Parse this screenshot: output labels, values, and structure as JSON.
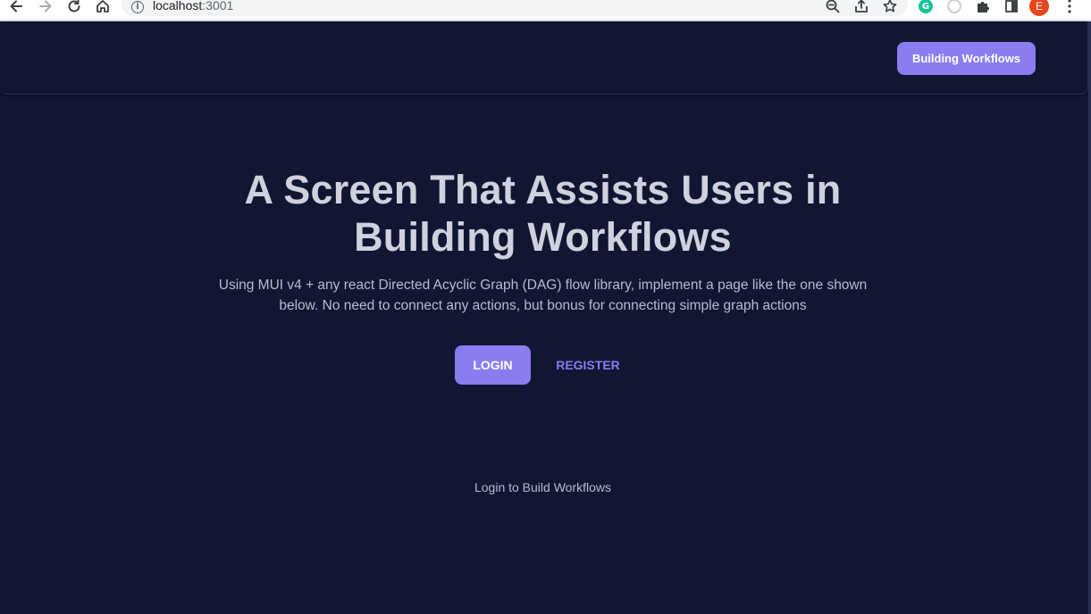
{
  "browser": {
    "url_host": "localhost",
    "url_port": ":3001",
    "profile_initial": "E",
    "grammarly_letter": "G",
    "icons": [
      "back-arrow-icon",
      "forward-arrow-icon",
      "reload-icon",
      "home-icon",
      "info-icon",
      "zoom-out-icon",
      "share-icon",
      "star-icon",
      "grammarly-icon",
      "extension-ring-icon",
      "puzzle-extensions-icon",
      "side-panel-icon",
      "profile-avatar",
      "kebab-menu-icon"
    ]
  },
  "appbar": {
    "button_label": "Building Workflows"
  },
  "hero": {
    "title": "A Screen That Assists Users in Building Workflows",
    "subtitle": "Using MUI v4 + any react Directed Acyclic Graph (DAG) flow library, implement a page like the one shown below. No need to connect any actions, but bonus for connecting simple graph actions"
  },
  "actions": {
    "login_label": "LOGIN",
    "register_label": "REGISTER"
  },
  "footer": {
    "text": "Login to Build Workflows"
  },
  "colors": {
    "background": "#111633",
    "accent": "#8b7cf0",
    "title_text": "#cfd1dc",
    "body_text": "#b9bccb"
  }
}
